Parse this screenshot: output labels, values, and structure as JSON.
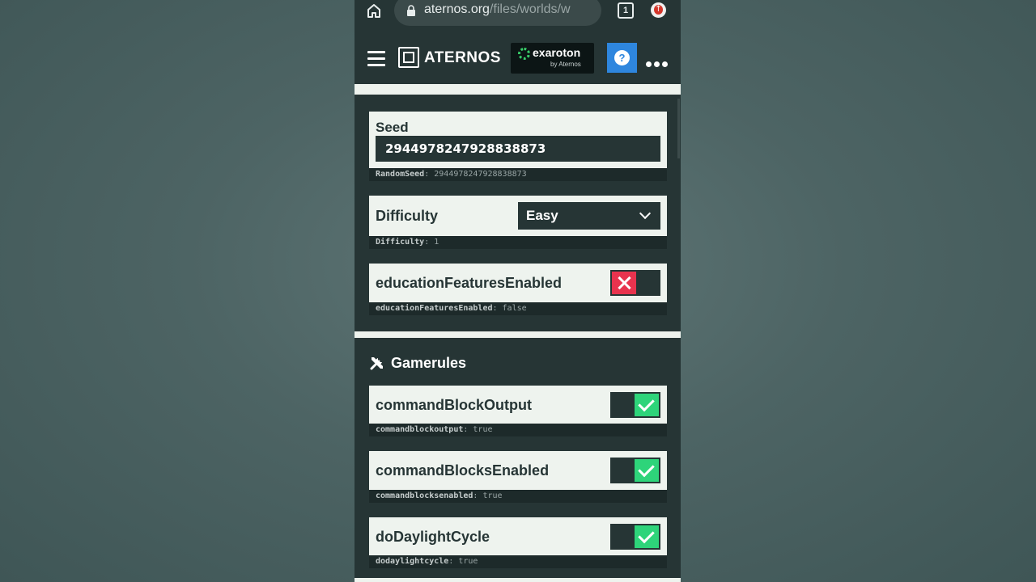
{
  "browser": {
    "url_main": "aternos.org",
    "url_path": "/files/worlds/w",
    "tab_count": "1"
  },
  "header": {
    "logo_text": "ATERNOS",
    "ad_brand": "exaroton",
    "ad_sub": "by Aternos",
    "help_label": "?"
  },
  "settings": {
    "seed": {
      "label": "Seed",
      "value": "2944978247928838873",
      "meta_key": "RandomSeed",
      "meta_value": ": 2944978247928838873"
    },
    "difficulty": {
      "label": "Difficulty",
      "value": "Easy",
      "meta_key": "Difficulty",
      "meta_value": ": 1"
    },
    "education": {
      "label": "educationFeaturesEnabled",
      "enabled": false,
      "meta_key": "educationFeaturesEnabled",
      "meta_value": ": false"
    }
  },
  "gamerules": {
    "title": "Gamerules",
    "items": [
      {
        "label": "commandBlockOutput",
        "enabled": true,
        "meta_key": "commandblockoutput",
        "meta_value": ": true"
      },
      {
        "label": "commandBlocksEnabled",
        "enabled": true,
        "meta_key": "commandblocksenabled",
        "meta_value": ": true"
      },
      {
        "label": "doDaylightCycle",
        "enabled": true,
        "meta_key": "dodaylightcycle",
        "meta_value": ": true"
      }
    ]
  },
  "colors": {
    "panel_dark": "#263535",
    "card_light": "#eef3ee",
    "toggle_on": "#2ed47a",
    "toggle_off": "#e8334e",
    "help_blue": "#2e86de"
  }
}
